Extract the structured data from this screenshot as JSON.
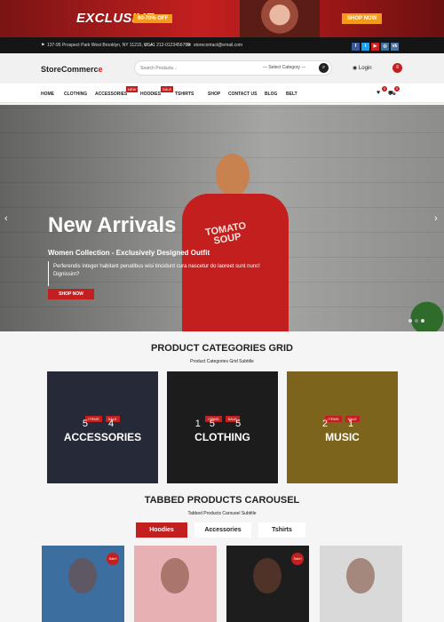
{
  "promo": {
    "headline": "EXCLUSIVE",
    "deal": "60-70% OFF",
    "cta": "SHOP NOW"
  },
  "topbar": {
    "address": "137-95 Prospect Park West Brooklyn, NY 11215, USA",
    "phone": "+1 212-0123456789",
    "email": "storecontact@email.com",
    "socials": [
      {
        "icon": "facebook-icon",
        "glyph": "f",
        "color": "#3b5998"
      },
      {
        "icon": "twitter-icon",
        "glyph": "t",
        "color": "#1da1f2"
      },
      {
        "icon": "youtube-icon",
        "glyph": "▶",
        "color": "#cd201f"
      },
      {
        "icon": "instagram-icon",
        "glyph": "◎",
        "color": "#3f729b"
      },
      {
        "icon": "vk-icon",
        "glyph": "vk",
        "color": "#4c75a3"
      }
    ]
  },
  "header": {
    "logo_main": "StoreCommerc",
    "logo_accent": "e",
    "search_placeholder": "Search Products...",
    "category_select": "--- Select Category ---",
    "login": "Login"
  },
  "nav": {
    "items": [
      "HOME",
      "CLOTHING",
      "ACCESSORIES",
      "HOODIES",
      "TSHIRTS",
      "SHOP",
      "CONTACT US",
      "BLOG",
      "BELT"
    ],
    "badges": {
      "accessories": "NEW",
      "hoodies": "SALE"
    },
    "cart_count": "0",
    "wishlist_count": "0"
  },
  "hero": {
    "title": "New Arrivals",
    "subtitle": "Women Collection - Exclusively Designed Outfit",
    "description": "Perferendis integer habitant penatibus wisi tincidunt cura nascetur do laoreet sunt nunc! Dignissim?",
    "cta": "SHOP NOW",
    "shirt_text_1": "TOMATO",
    "shirt_text_2": "SOUP"
  },
  "categories": {
    "title": "PRODUCT CATEGORIES GRID",
    "subtitle": "Product Categories Grid Subtitle",
    "items_label": "ITEMS",
    "sale_label": "SALE",
    "cards": [
      {
        "name": "ACCESSORIES",
        "items": "5",
        "sale": "4",
        "color": "#3a3f57"
      },
      {
        "name": "CLOTHING",
        "items": "15",
        "sale": "5",
        "color": "#2c2c2c"
      },
      {
        "name": "MUSIC",
        "items": "2",
        "sale": "1",
        "color": "#c19a2b"
      }
    ]
  },
  "tabbed": {
    "title": "TABBED PRODUCTS CAROUSEL",
    "subtitle": "Tabbed Products Carousel Subtitle",
    "tabs": [
      "Hoodies",
      "Accessories",
      "Tshirts"
    ],
    "sale_label": "Sale!",
    "products": [
      {
        "bg": "#3c6fa0",
        "sale": true
      },
      {
        "bg": "#e7b0b3",
        "sale": false
      },
      {
        "bg": "#1d1d1d",
        "sale": true
      },
      {
        "bg": "#d9d9d9",
        "sale": false
      }
    ]
  }
}
